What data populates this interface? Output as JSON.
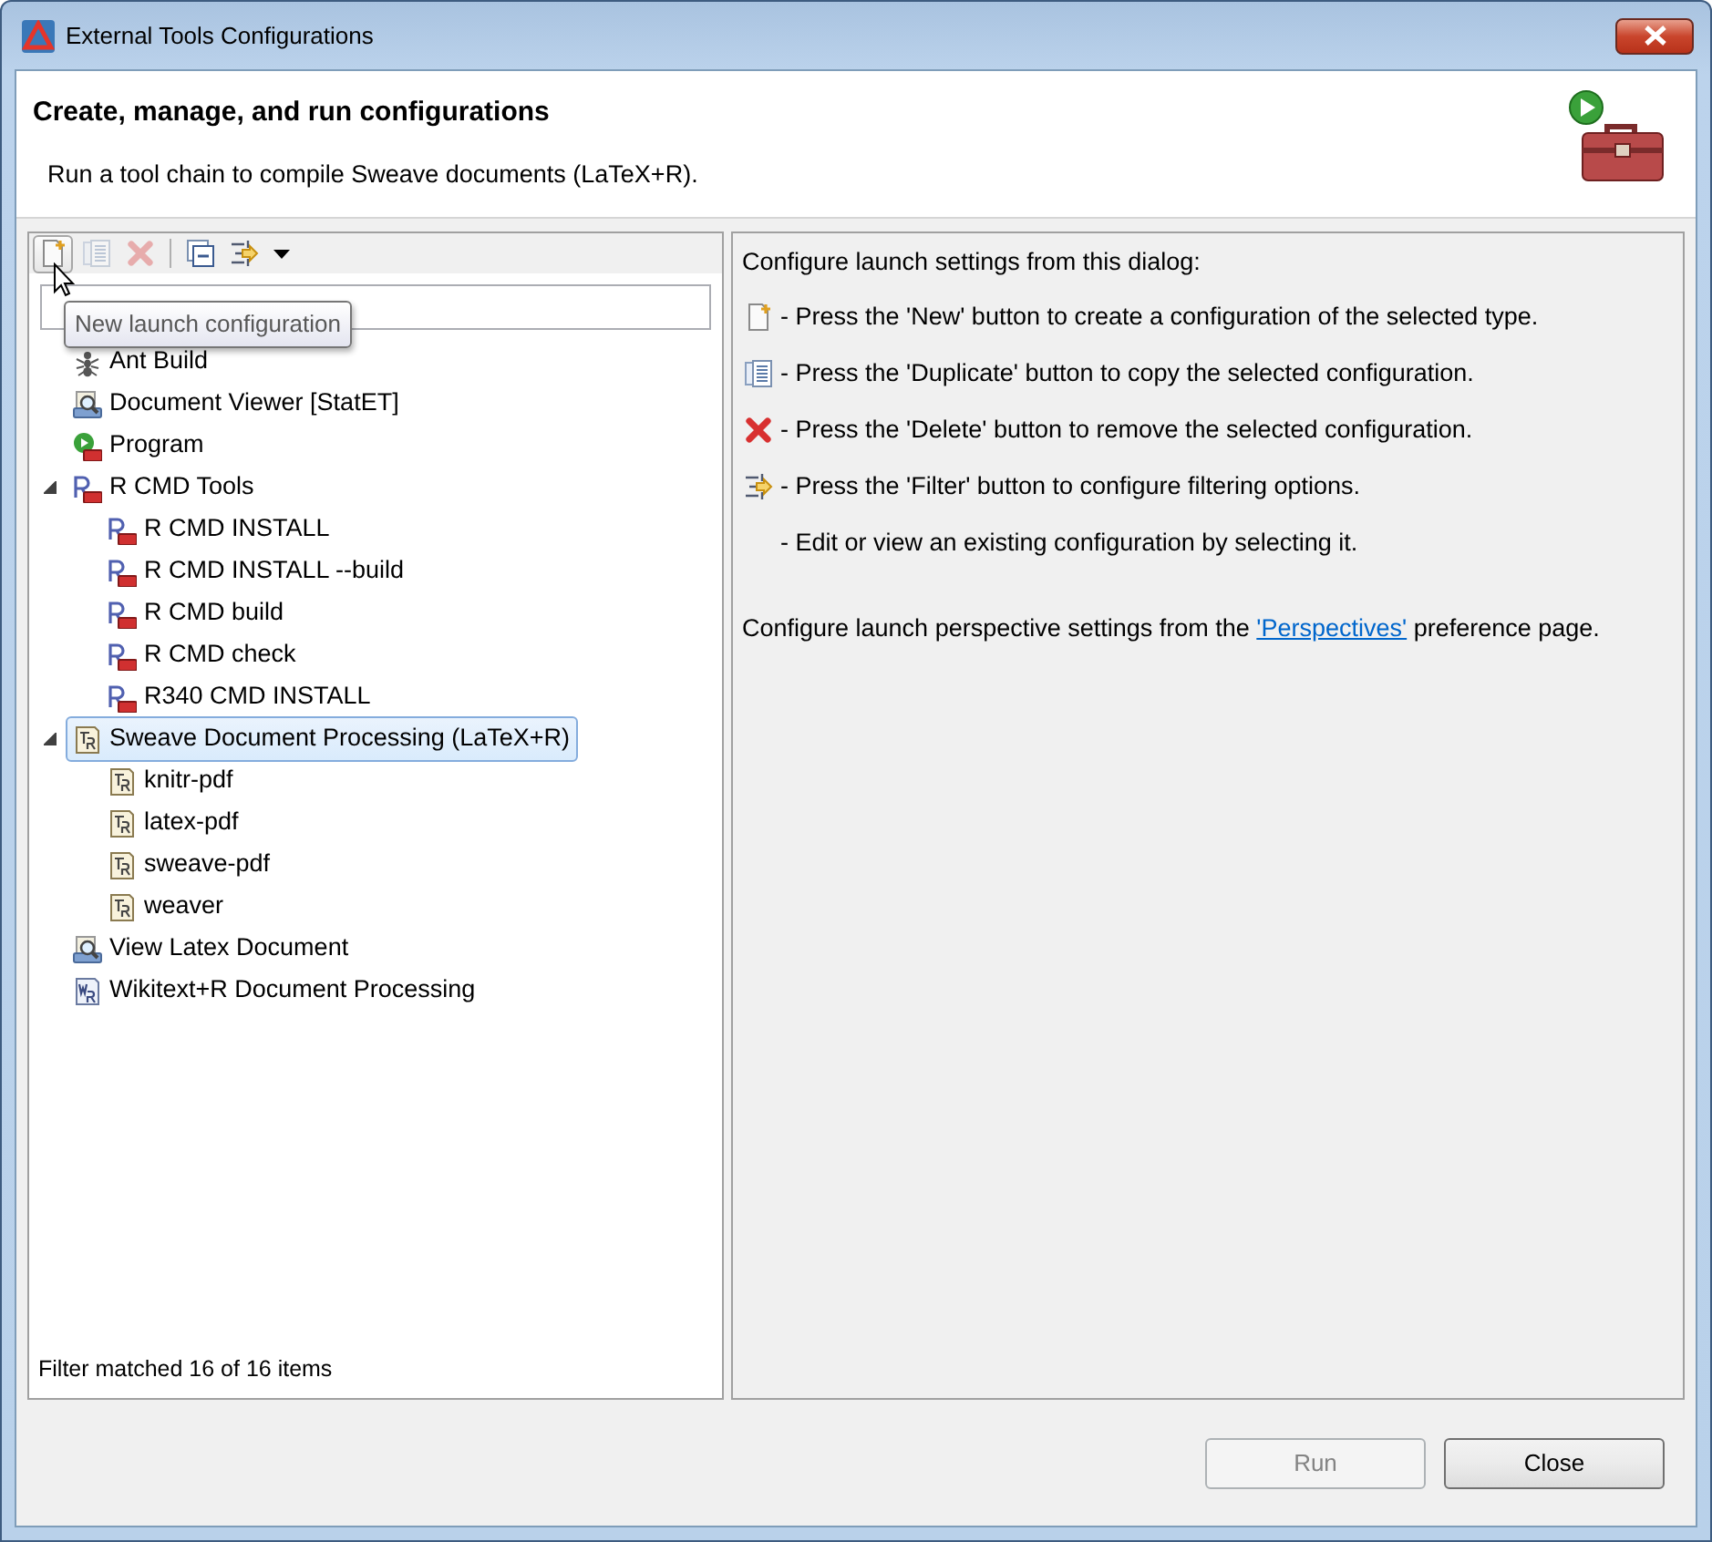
{
  "window": {
    "title": "External Tools Configurations"
  },
  "header": {
    "title": "Create, manage, and run configurations",
    "message": "Run a tool chain to compile Sweave documents (LaTeX+R)."
  },
  "toolbar": [
    {
      "kind": "new",
      "disabled": false,
      "hovered": true
    },
    {
      "kind": "duplicate",
      "disabled": true,
      "hovered": false
    },
    {
      "kind": "delete",
      "disabled": true,
      "hovered": false
    },
    {
      "kind": "collapse",
      "disabled": false,
      "hovered": false
    },
    {
      "kind": "filter",
      "disabled": false,
      "hovered": false
    },
    {
      "kind": "menu",
      "disabled": false,
      "hovered": false
    }
  ],
  "tooltip": "New launch configuration",
  "tree": [
    {
      "label": "Ant Build",
      "kind": "ant",
      "selected": false
    },
    {
      "label": "Document Viewer  [StatET]",
      "kind": "viewer",
      "selected": false
    },
    {
      "label": "Program",
      "kind": "program",
      "selected": false
    },
    {
      "label": "R CMD Tools",
      "kind": "rcmd",
      "selected": false,
      "expanded": true,
      "children": [
        {
          "label": "R CMD INSTALL",
          "kind": "rcmd",
          "selected": false
        },
        {
          "label": "R CMD INSTALL --build",
          "kind": "rcmd",
          "selected": false
        },
        {
          "label": "R CMD build",
          "kind": "rcmd",
          "selected": false
        },
        {
          "label": "R CMD check",
          "kind": "rcmd",
          "selected": false
        },
        {
          "label": "R340 CMD INSTALL",
          "kind": "rcmd",
          "selected": false
        }
      ]
    },
    {
      "label": "Sweave Document Processing (LaTeX+R)",
      "kind": "sweave",
      "selected": true,
      "expanded": true,
      "children": [
        {
          "label": "knitr-pdf",
          "kind": "sweave",
          "selected": false
        },
        {
          "label": "latex-pdf",
          "kind": "sweave",
          "selected": false
        },
        {
          "label": "sweave-pdf",
          "kind": "sweave",
          "selected": false
        },
        {
          "label": "weaver",
          "kind": "sweave",
          "selected": false
        }
      ]
    },
    {
      "label": "View Latex Document",
      "kind": "viewer",
      "selected": false
    },
    {
      "label": "Wikitext+R Document Processing",
      "kind": "wikitext",
      "selected": false
    }
  ],
  "filter_status": "Filter matched 16 of 16 items",
  "info": {
    "intro": "Configure launch settings from this dialog:",
    "items": [
      {
        "kind": "new",
        "text": "- Press the 'New' button to create a configuration of the selected type."
      },
      {
        "kind": "duplicate",
        "text": "- Press the 'Duplicate' button to copy the selected configuration."
      },
      {
        "kind": "delete",
        "text": "- Press the 'Delete' button to remove the selected configuration."
      },
      {
        "kind": "filter",
        "text": "- Press the 'Filter' button to configure filtering options."
      },
      {
        "kind": "plain",
        "text": "- Edit or view an existing configuration by selecting it."
      }
    ],
    "perspective_before": "Configure launch perspective settings from the ",
    "perspective_link": "'Perspectives'",
    "perspective_after": " preference page."
  },
  "buttons": [
    {
      "label": "Run",
      "disabled": true
    },
    {
      "label": "Close",
      "disabled": false
    }
  ]
}
